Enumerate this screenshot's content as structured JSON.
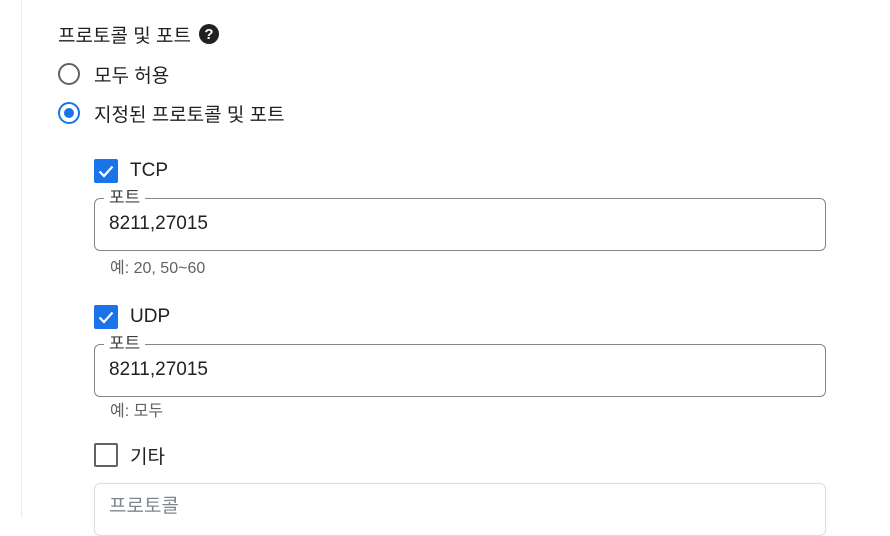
{
  "section": {
    "title": "프로토콜 및 포트",
    "help_icon": "help-icon"
  },
  "radios": {
    "allow_all": {
      "label": "모두 허용",
      "checked": false
    },
    "specified": {
      "label": "지정된 프로토콜 및 포트",
      "checked": true
    }
  },
  "tcp": {
    "label": "TCP",
    "checked": true,
    "port_label": "포트",
    "port_value": "8211,27015",
    "hint": "예: 20, 50~60"
  },
  "udp": {
    "label": "UDP",
    "checked": true,
    "port_label": "포트",
    "port_value": "8211,27015",
    "hint": "예: 모두"
  },
  "other": {
    "label": "기타",
    "checked": false,
    "protocol_placeholder": "프로토콜"
  },
  "colors": {
    "accent": "#1a73e8",
    "outline": "#80868b",
    "text": "#202124",
    "secondary": "#5f6368"
  }
}
